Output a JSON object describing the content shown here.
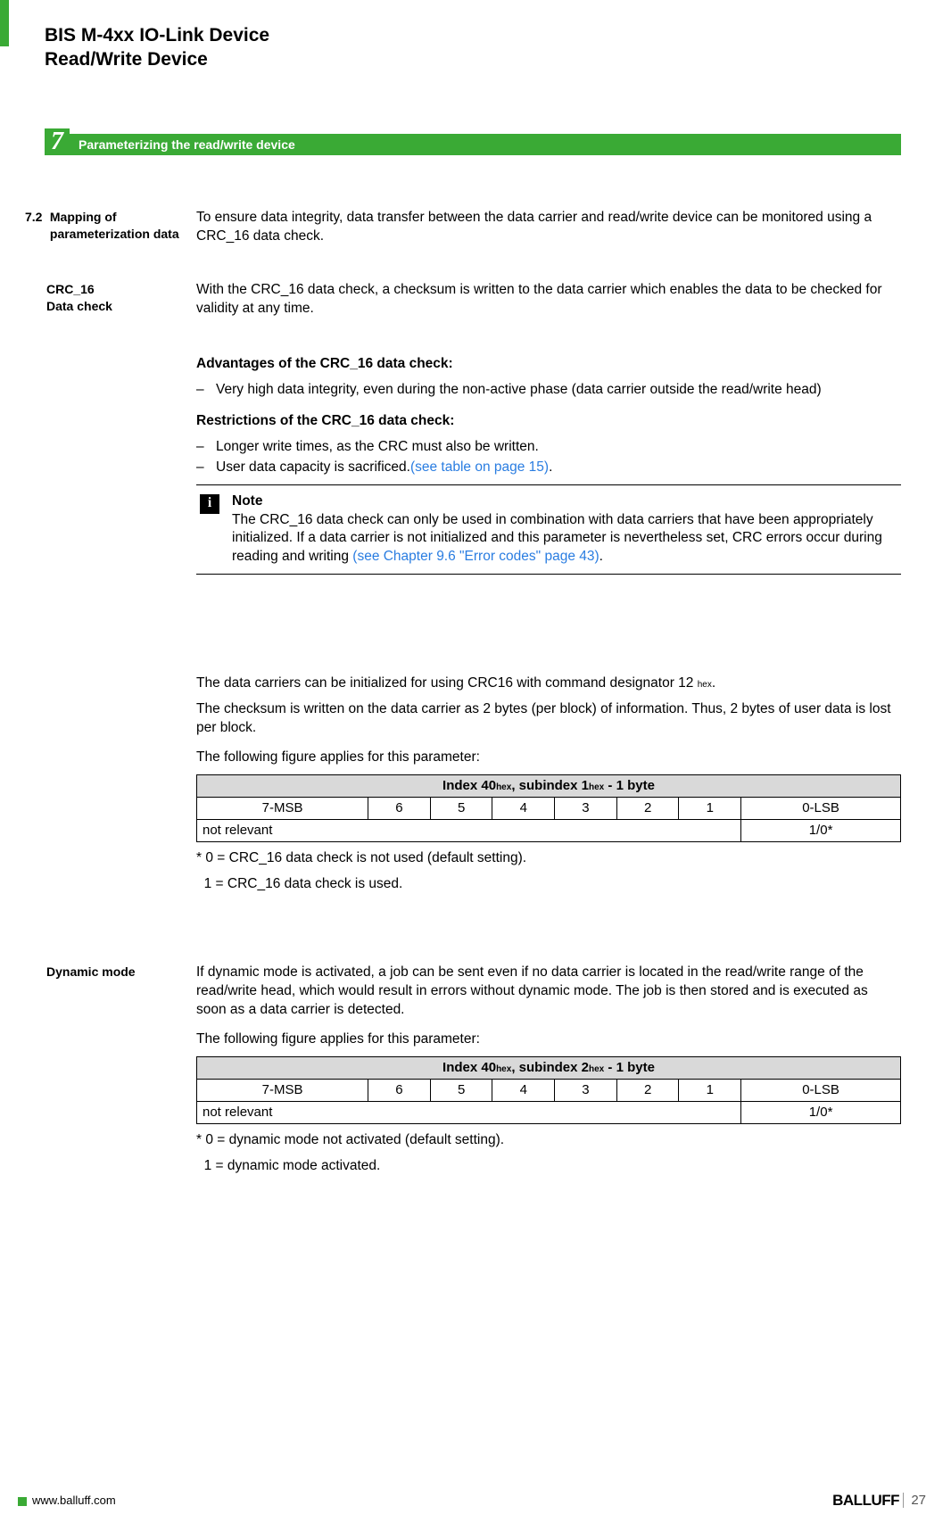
{
  "header": {
    "line1": "BIS M-4xx IO-Link Device",
    "line2": "Read/Write Device"
  },
  "section": {
    "number": "7",
    "title": "Parameterizing the read/write device"
  },
  "sub72": {
    "num": "7.2",
    "title": "Mapping of parameterization data",
    "intro": "To ensure data integrity, data transfer between the  data carrier and read/write device can be monitored using a CRC_16 data check."
  },
  "crc16": {
    "label_line1": "CRC_16",
    "label_line2": "Data check",
    "desc": "With the CRC_16 data check, a checksum is written to the data carrier which enables the data to be checked for validity at any time.",
    "adv_title": "Advantages of the CRC_16 data check:",
    "adv_items": [
      "Very high data integrity, even during the non-active phase (data carrier outside the read/write head)"
    ],
    "restr_title": "Restrictions of the CRC_16 data check:",
    "restr_items": [
      "Longer write times, as the CRC must also be written.",
      "User data capacity is sacrificed."
    ],
    "restr_link": "(see table on page 15)",
    "note_label": "Note",
    "note_text_pre": "The CRC_16 data check can only be used in combination with data carriers that have been appropriately initialized. If a data carrier is not initialized and this parameter is nevertheless set, CRC errors occur during reading and writing ",
    "note_link": "(see Chapter 9.6 \"Error codes\" page 43)",
    "note_text_post": ".",
    "init_p1_pre": "The data carriers can be initialized for using CRC16 with command designator 12 ",
    "init_hex": "hex",
    "init_p1_post": ".",
    "init_p2": "The checksum is written on the data carrier as 2 bytes (per block) of information. Thus, 2 bytes of user data is lost per block.",
    "fig_line": "The following figure applies for this parameter:",
    "foot_star": "* 0 = CRC_16 data check is not used (default setting).",
    "foot_one": "  1 = CRC_16 data check is used."
  },
  "table_crc": {
    "caption_pre": "Index 40",
    "caption_mid": ", subindex 1",
    "caption_post": " - 1 byte",
    "bits": [
      "7-MSB",
      "6",
      "5",
      "4",
      "3",
      "2",
      "1",
      "0-LSB"
    ],
    "row_label": "not relevant",
    "row_val": "1/0*"
  },
  "dynamic": {
    "label": "Dynamic mode",
    "desc": "If dynamic mode is activated, a job can be sent even if no data carrier is located in the read/write range of the read/write head, which would result in errors without dynamic mode. The job is then stored and is executed as soon as a data carrier is detected.",
    "fig_line": "The following figure applies for this parameter:",
    "foot_star": "* 0 = dynamic mode not activated (default setting).",
    "foot_one": "  1 = dynamic mode activated."
  },
  "table_dyn": {
    "caption_pre": "Index 40",
    "caption_mid": ", subindex 2",
    "caption_post": " - 1 byte",
    "bits": [
      "7-MSB",
      "6",
      "5",
      "4",
      "3",
      "2",
      "1",
      "0-LSB"
    ],
    "row_label": "not relevant",
    "row_val": "1/0*"
  },
  "footer": {
    "url": "www.balluff.com",
    "brand": "BALLUFF",
    "page": "27"
  }
}
